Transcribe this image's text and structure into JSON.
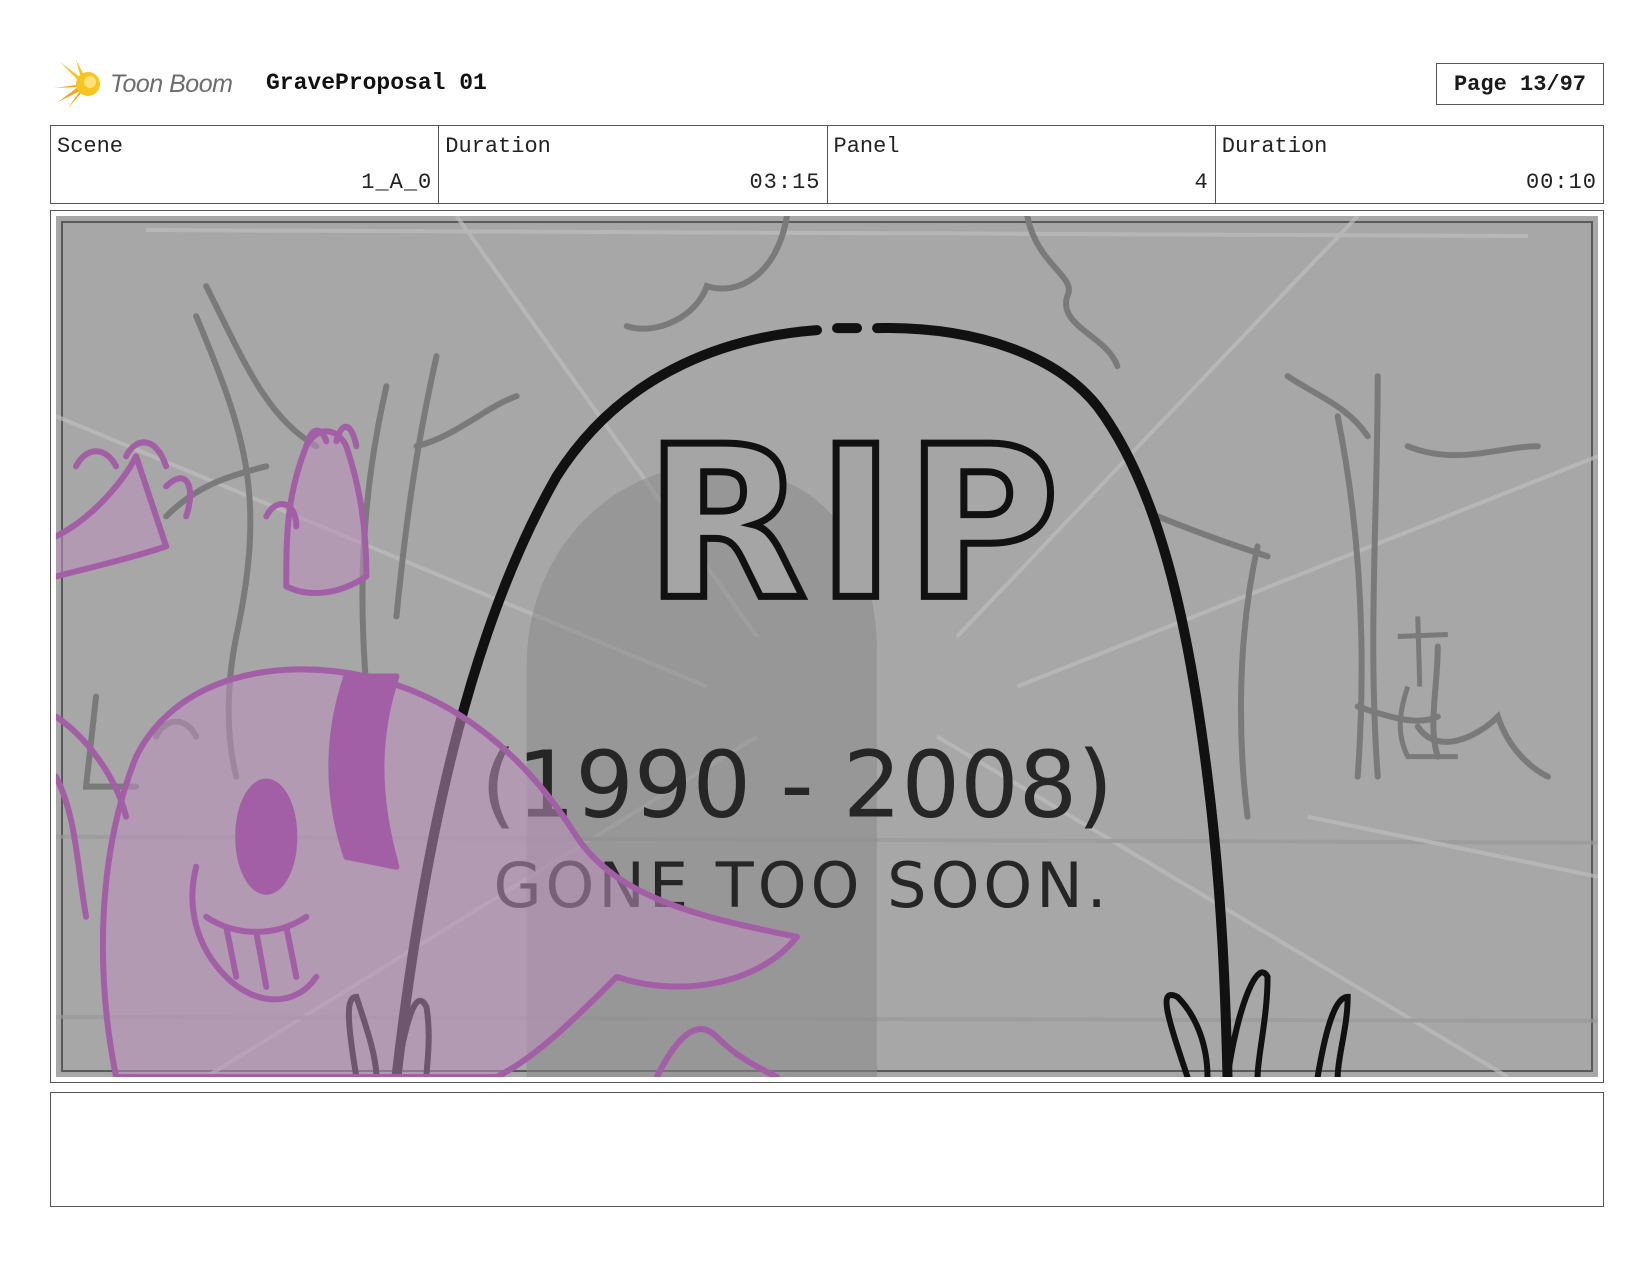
{
  "header": {
    "logo_text": "Toon Boom",
    "project_title": "GraveProposal 01",
    "page_label": "Page 13/97"
  },
  "info": {
    "scene_label": "Scene",
    "scene_value": "1_A_0",
    "scene_duration_label": "Duration",
    "scene_duration_value": "03:15",
    "panel_label": "Panel",
    "panel_value": "4",
    "panel_duration_label": "Duration",
    "panel_duration_value": "00:10"
  },
  "panel": {
    "tombstone_line1": "RIP",
    "tombstone_line2": "(1990 - 2008)",
    "tombstone_line3": "GONE TOO SOON."
  },
  "notes": {
    "text": ""
  },
  "colors": {
    "sky_gray": "#a6a6a6",
    "tree_gray": "#7c7c7c",
    "character_purple": "#a35fa6",
    "ink": "#111111",
    "logo_yellow": "#f6c21b"
  }
}
